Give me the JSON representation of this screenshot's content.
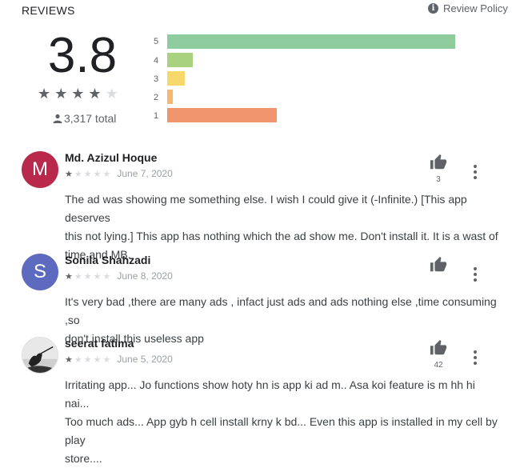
{
  "header": {
    "title": "REVIEWS",
    "policy_label": "Review Policy"
  },
  "summary": {
    "score": "3.8",
    "star_rating": 4,
    "total": "3,317 total",
    "distribution": [
      {
        "label": "5",
        "fraction": 1.0,
        "color": "#8ecb9d"
      },
      {
        "label": "4",
        "fraction": 0.09,
        "color": "#a8d27f"
      },
      {
        "label": "3",
        "fraction": 0.06,
        "color": "#f7d86b"
      },
      {
        "label": "2",
        "fraction": 0.02,
        "color": "#f6b86d"
      },
      {
        "label": "1",
        "fraction": 0.38,
        "color": "#f0956d"
      }
    ]
  },
  "reviews": [
    {
      "name": "Md. Azizul Hoque",
      "avatar_letter": "M",
      "avatar_color": "#b8294b",
      "stars": 1,
      "date": "June 7, 2020",
      "likes": "3",
      "lines": [
        "The ad was showing me something else. I wish I could give it (-Infinite.) [This app deserves",
        "this not lying.] This app has nothing which the ad show me. Don't install it. It is a wast of",
        "time and MB."
      ]
    },
    {
      "name": "Sonila Shahzadi",
      "avatar_letter": "S",
      "avatar_color": "#5c6bc0",
      "stars": 1,
      "date": "June 8, 2020",
      "likes": "",
      "lines": [
        "It's very bad ,there are many ads , infact just ads and ads nothing else ,time consuming ,so",
        "don't install this useless app"
      ]
    },
    {
      "name": "seerat fatima",
      "avatar_letter": "",
      "avatar_color": "#e6e6e6",
      "stars": 1,
      "date": "June 5, 2020",
      "likes": "42",
      "lines": [
        "Irritating app... Jo functions show hoty hn is app ki ad m.. Asa koi feature is m hh hi nai...",
        "Too much ads... App gyb h cell install krny k bd... Even this app is installed in my cell by play",
        "store...."
      ]
    }
  ]
}
